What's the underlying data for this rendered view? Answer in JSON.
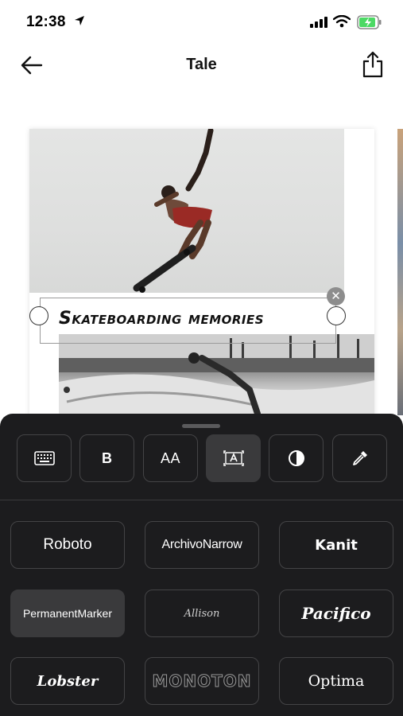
{
  "status_bar": {
    "time": "12:38"
  },
  "nav": {
    "title": "Tale"
  },
  "canvas": {
    "caption": "Skateboarding memories",
    "close_symbol": "✕"
  },
  "toolbar": {
    "tools": [
      {
        "name": "keyboard",
        "icon": "keyboard-icon"
      },
      {
        "name": "bold",
        "label": "B"
      },
      {
        "name": "text-size",
        "label": "AA"
      },
      {
        "name": "text-background",
        "icon": "text-background-icon",
        "active": true
      },
      {
        "name": "contrast",
        "icon": "contrast-icon"
      },
      {
        "name": "color-picker",
        "icon": "eyedropper-icon"
      }
    ]
  },
  "fonts": [
    {
      "label": "Roboto"
    },
    {
      "label": "ArchivoNarrow"
    },
    {
      "label": "Kanit"
    },
    {
      "label": "PermanentMarker",
      "selected": true
    },
    {
      "label": "Allison"
    },
    {
      "label": "Pacifico"
    },
    {
      "label": "Lobster"
    },
    {
      "label": "MONOTON"
    },
    {
      "label": "Optima"
    }
  ],
  "colors": {
    "sheet_bg": "#1c1c1e",
    "tile_border": "#444446",
    "tile_active": "#3a3a3c"
  }
}
